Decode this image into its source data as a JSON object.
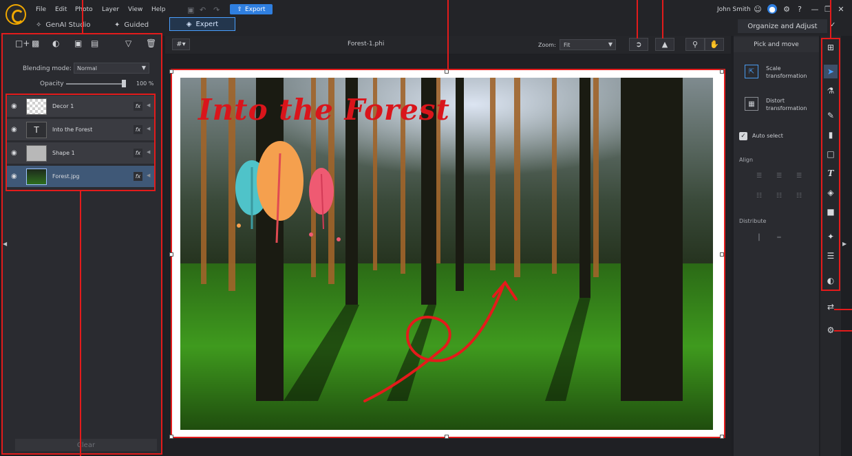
{
  "app": {
    "menu": [
      "File",
      "Edit",
      "Photo",
      "Layer",
      "View",
      "Help"
    ],
    "export_label": "Export",
    "modes": {
      "genai": "GenAI Studio",
      "guided": "Guided",
      "expert": "Expert"
    },
    "user_name": "John Smith",
    "organize_label": "Organize and Adjust"
  },
  "layers_panel": {
    "blending_label": "Blending mode:",
    "blending_value": "Normal",
    "opacity_label": "Opacity",
    "opacity_value": "100 %",
    "opacity_level": 1.0,
    "layers": [
      {
        "name": "Decor 1",
        "selected": false
      },
      {
        "name": "Into the Forest",
        "selected": false
      },
      {
        "name": "Shape 1",
        "selected": false
      },
      {
        "name": "Forest.jpg",
        "selected": true
      }
    ],
    "fx_label": "fx",
    "text_layer_glyph": "T",
    "clear_label": "Clear"
  },
  "canvas": {
    "file_name": "Forest-1.phi",
    "zoom_label": "Zoom:",
    "zoom_value": "Fit",
    "overlay_text": "Into the Forest"
  },
  "right_panel": {
    "header": "Pick and move",
    "scale_label": "Scale transformation",
    "distort_label": "Distort transformation",
    "auto_select_label": "Auto select",
    "auto_select_checked": true,
    "align_label": "Align",
    "distribute_label": "Distribute"
  },
  "tools": [
    "crop-icon",
    "move-icon",
    "clone-icon",
    "brush-icon",
    "eraser-icon",
    "rectangle-icon",
    "text-icon",
    "fill-icon",
    "gradient-icon",
    "magic-wand-icon",
    "adjust-icon",
    "mask-icon",
    "transfer-icon",
    "settings-icon"
  ],
  "colors": {
    "accent": "#2f7fe0",
    "annotation": "#e41b1b",
    "title_text": "#d9151b"
  }
}
